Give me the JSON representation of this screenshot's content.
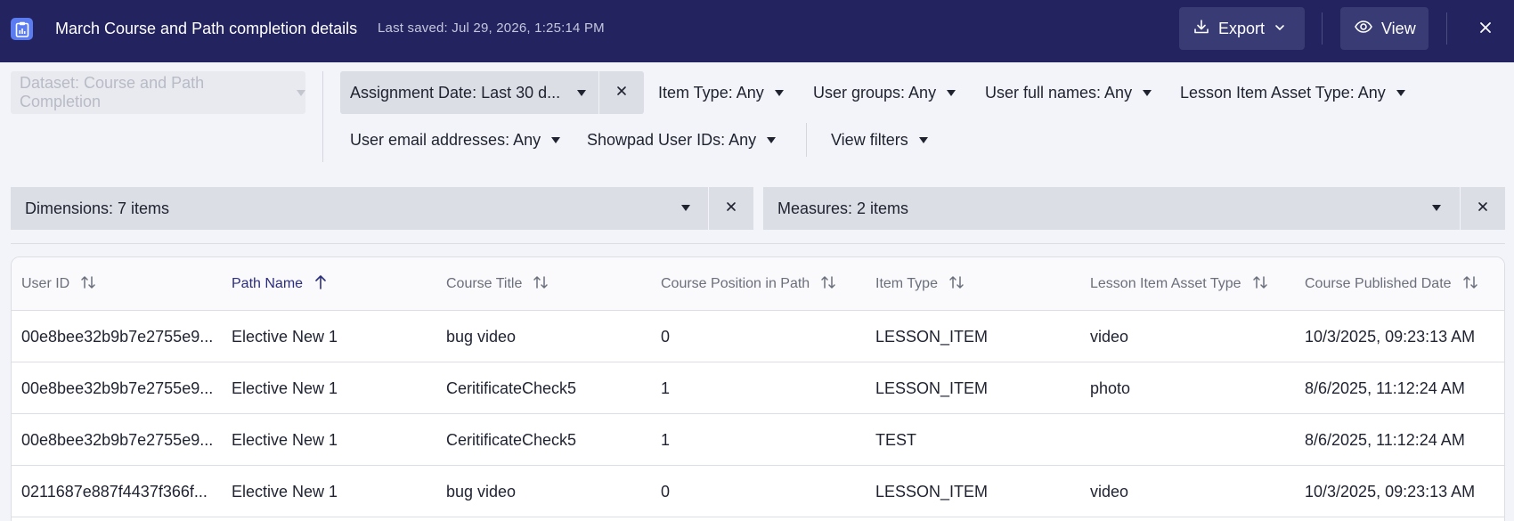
{
  "header": {
    "title": "March Course and Path completion details",
    "last_saved": "Last saved: Jul 29, 2026, 1:25:14 PM",
    "export_label": "Export",
    "view_label": "View"
  },
  "filters": {
    "dataset": "Dataset: Course and Path Completion",
    "assignment_date": "Assignment Date: Last 30 d...",
    "item_type": "Item Type: Any",
    "user_groups": "User groups: Any",
    "user_full_names": "User full names: Any",
    "lesson_item_asset_type": "Lesson Item Asset Type: Any",
    "user_email_addresses": "User email addresses: Any",
    "showpad_user_ids": "Showpad User IDs: Any",
    "view_filters": "View filters"
  },
  "dimensions_label": "Dimensions: 7 items",
  "measures_label": "Measures: 2 items",
  "table": {
    "columns": [
      "User ID",
      "Path Name",
      "Course Title",
      "Course Position in Path",
      "Item Type",
      "Lesson Item Asset Type",
      "Course Published Date"
    ],
    "sorted_column": "Path Name",
    "rows": [
      [
        "00e8bee32b9b7e2755e9...",
        "Elective New 1",
        "bug video",
        "0",
        "LESSON_ITEM",
        "video",
        "10/3/2025, 09:23:13 AM"
      ],
      [
        "00e8bee32b9b7e2755e9...",
        "Elective New 1",
        "CeritificateCheck5",
        "1",
        "LESSON_ITEM",
        "photo",
        "8/6/2025, 11:12:24 AM"
      ],
      [
        "00e8bee32b9b7e2755e9...",
        "Elective New 1",
        "CeritificateCheck5",
        "1",
        "TEST",
        "",
        "8/6/2025, 11:12:24 AM"
      ],
      [
        "0211687e887f4437f366f...",
        "Elective New 1",
        "bug video",
        "0",
        "LESSON_ITEM",
        "video",
        "10/3/2025, 09:23:13 AM"
      ]
    ]
  },
  "colors": {
    "header_bg": "#23235f",
    "accent": "#2b2d7d",
    "app_icon": "#5a7cf0"
  }
}
